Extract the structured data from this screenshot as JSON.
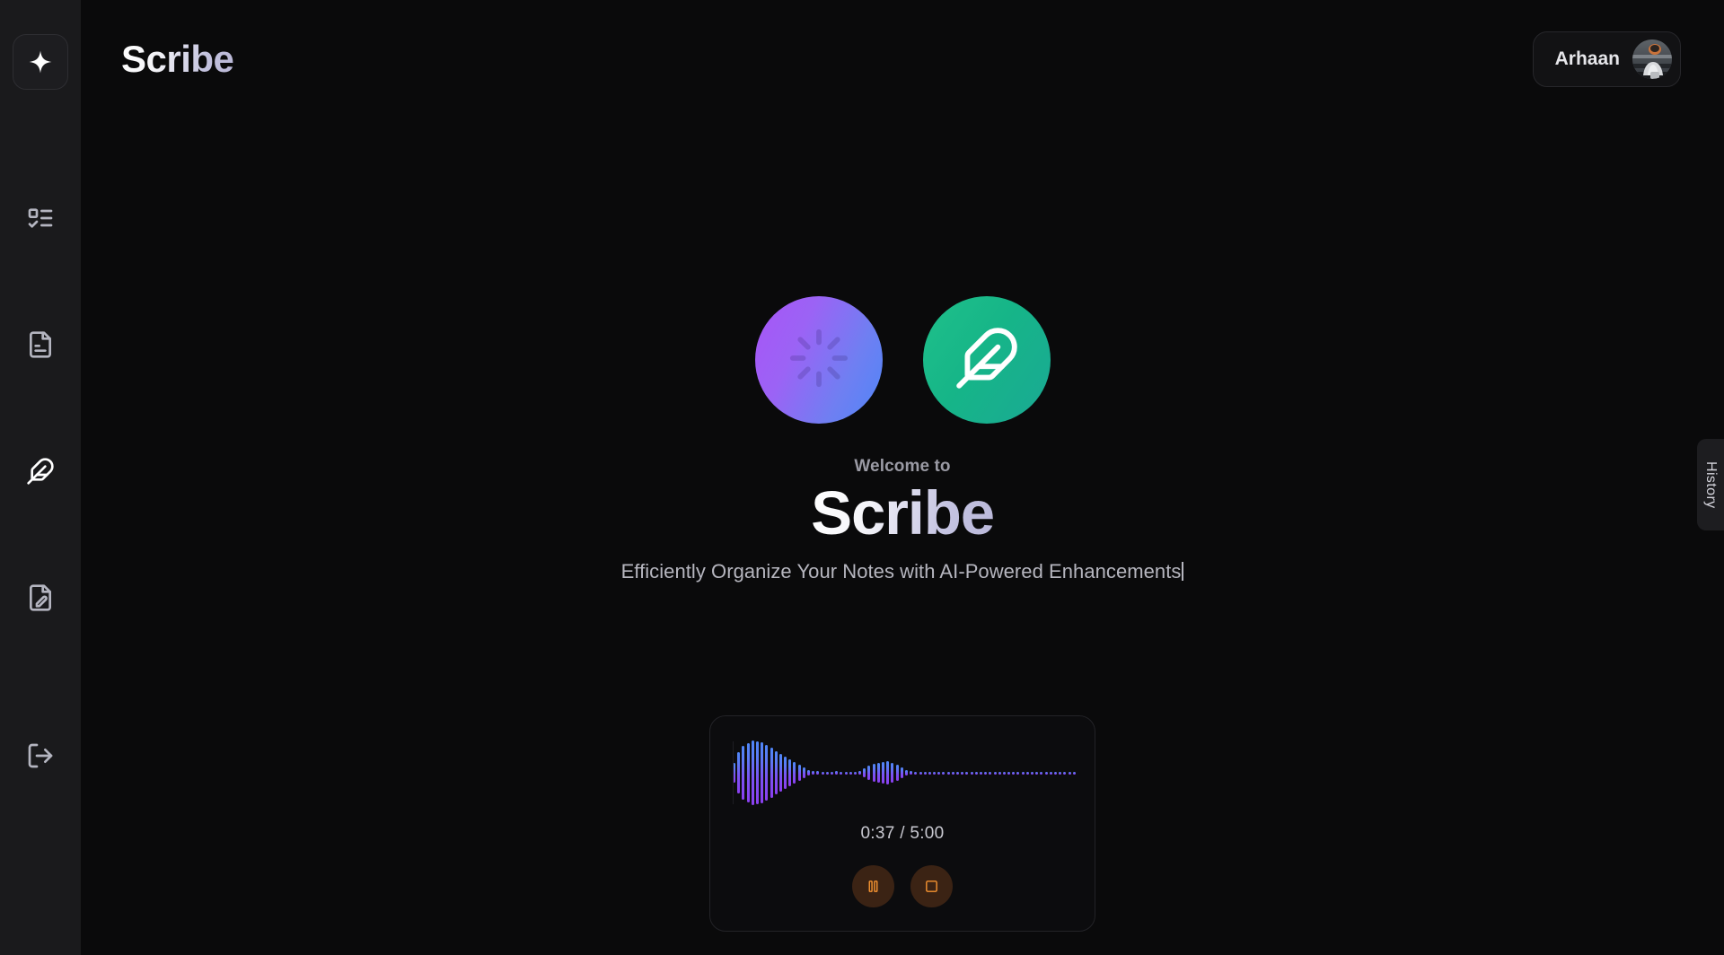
{
  "app": {
    "name": "Scribe",
    "background": "#0a0a0b",
    "sidebar_background": "#1a1a1c"
  },
  "sidebar": {
    "logo": {
      "icon": "sparkle-star-icon",
      "label": "Scribe"
    },
    "items": [
      {
        "icon": "list-todo-icon",
        "label": "Tasks"
      },
      {
        "icon": "file-text-icon",
        "label": "Notes"
      },
      {
        "icon": "feather-icon",
        "label": "Write"
      },
      {
        "icon": "file-pen-icon",
        "label": "Edit Document"
      }
    ],
    "footer": {
      "icon": "log-out-icon",
      "label": "Log out"
    }
  },
  "header": {
    "title": "Scribe",
    "title_gradient": [
      "#ffffff",
      "#b9b7d6"
    ],
    "user": {
      "name": "Arhaan",
      "avatar": "user-avatar-photo"
    }
  },
  "hero": {
    "icons": [
      {
        "name": "loader-icon",
        "circle_gradient": [
          "#a855f7",
          "#4f86f7"
        ]
      },
      {
        "name": "feather-icon",
        "circle_gradient": [
          "#1fc08a",
          "#1aa994"
        ]
      }
    ],
    "eyebrow": "Welcome to",
    "title": "Scribe",
    "subtitle": "Efficiently Organize Your Notes with AI-Powered Enhancements",
    "subtitle_has_caret": true
  },
  "recorder": {
    "time_elapsed": "0:37",
    "time_total": "5:00",
    "time_readout": "0:37 / 5:00",
    "waveform_gradient": [
      "#8b3ff0",
      "#4f86f7"
    ],
    "waveform_amplitudes": [
      22,
      46,
      60,
      66,
      72,
      70,
      68,
      62,
      56,
      48,
      42,
      36,
      30,
      24,
      18,
      12,
      6,
      4,
      4,
      3,
      3,
      3,
      4,
      3,
      3,
      3,
      3,
      4,
      10,
      16,
      20,
      22,
      24,
      26,
      22,
      18,
      12,
      6,
      4,
      3,
      3,
      3,
      3,
      3,
      3,
      3,
      3,
      3,
      3,
      3,
      3,
      3,
      3,
      3,
      3,
      3,
      3,
      3,
      3,
      3,
      3,
      3,
      3,
      3,
      3,
      3,
      3,
      3,
      3,
      3,
      3,
      3,
      3,
      3
    ],
    "controls": [
      {
        "name": "pause-button",
        "icon": "pause-icon",
        "color": "#f59331",
        "background": "#3b2314",
        "label": "Pause"
      },
      {
        "name": "stop-button",
        "icon": "stop-square-icon",
        "color": "#f59331",
        "background": "#3b2314",
        "label": "Stop"
      }
    ]
  },
  "history_panel": {
    "tab_label": "History"
  }
}
